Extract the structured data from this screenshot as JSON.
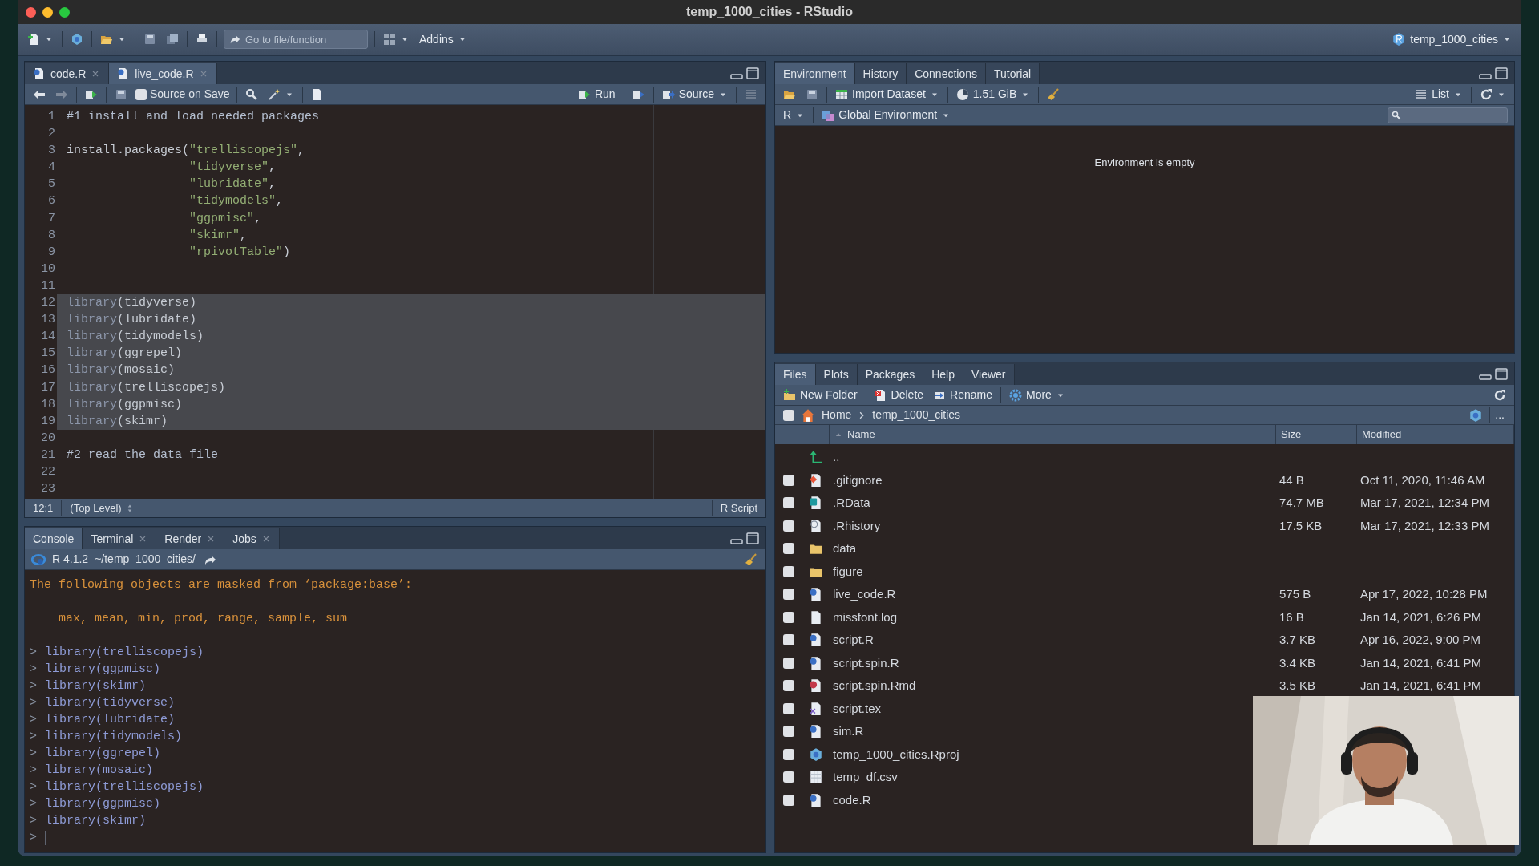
{
  "window": {
    "title": "temp_1000_cities - RStudio"
  },
  "toolbar": {
    "goto_placeholder": "Go to file/function",
    "addins": "Addins",
    "project": "temp_1000_cities"
  },
  "editor": {
    "tabs": [
      {
        "label": "code.R",
        "selected": false,
        "closable": true
      },
      {
        "label": "live_code.R",
        "selected": true,
        "closable": true
      }
    ],
    "toolbar": {
      "source_on_save": {
        "label": "Source on Save",
        "checked": false
      },
      "run": "Run",
      "source": "Source"
    },
    "lines": [
      {
        "num": "1",
        "selected": false,
        "tokens": [
          {
            "kind": "comment",
            "text": "#1 install and load needed packages"
          }
        ]
      },
      {
        "num": "2",
        "selected": false
      },
      {
        "num": "3",
        "selected": false,
        "tokens": [
          {
            "kind": "plain",
            "text": "install.packages("
          },
          {
            "kind": "string",
            "text": "\"trelliscopejs\""
          },
          {
            "kind": "plain",
            "text": ","
          }
        ]
      },
      {
        "num": "4",
        "selected": false,
        "kind": "continuation",
        "tokens": [
          {
            "kind": "string",
            "text": "\"tidyverse\""
          },
          {
            "kind": "plain",
            "text": ","
          }
        ]
      },
      {
        "num": "5",
        "selected": false,
        "kind": "continuation",
        "tokens": [
          {
            "kind": "string",
            "text": "\"lubridate\""
          },
          {
            "kind": "plain",
            "text": ","
          }
        ]
      },
      {
        "num": "6",
        "selected": false,
        "kind": "continuation",
        "tokens": [
          {
            "kind": "string",
            "text": "\"tidymodels\""
          },
          {
            "kind": "plain",
            "text": ","
          }
        ]
      },
      {
        "num": "7",
        "selected": false,
        "kind": "continuation",
        "tokens": [
          {
            "kind": "string",
            "text": "\"ggpmisc\""
          },
          {
            "kind": "plain",
            "text": ","
          }
        ]
      },
      {
        "num": "8",
        "selected": false,
        "kind": "continuation",
        "tokens": [
          {
            "kind": "string",
            "text": "\"skimr\""
          },
          {
            "kind": "plain",
            "text": ","
          }
        ]
      },
      {
        "num": "9",
        "selected": false,
        "kind": "continuation",
        "tokens": [
          {
            "kind": "string",
            "text": "\"rpivotTable\""
          },
          {
            "kind": "plain",
            "text": ")"
          }
        ]
      },
      {
        "num": "10",
        "selected": false
      },
      {
        "num": "11",
        "selected": false
      },
      {
        "num": "12",
        "selected": true,
        "tokens": [
          {
            "kind": "keyword",
            "text": "library"
          },
          {
            "kind": "plain",
            "text": "(tidyverse)"
          }
        ]
      },
      {
        "num": "13",
        "selected": true,
        "tokens": [
          {
            "kind": "keyword",
            "text": "library"
          },
          {
            "kind": "plain",
            "text": "(lubridate)"
          }
        ]
      },
      {
        "num": "14",
        "selected": true,
        "tokens": [
          {
            "kind": "keyword",
            "text": "library"
          },
          {
            "kind": "plain",
            "text": "(tidymodels)"
          }
        ]
      },
      {
        "num": "15",
        "selected": true,
        "tokens": [
          {
            "kind": "keyword",
            "text": "library"
          },
          {
            "kind": "plain",
            "text": "(ggrepel)"
          }
        ]
      },
      {
        "num": "16",
        "selected": true,
        "tokens": [
          {
            "kind": "keyword",
            "text": "library"
          },
          {
            "kind": "plain",
            "text": "(mosaic)"
          }
        ]
      },
      {
        "num": "17",
        "selected": true,
        "tokens": [
          {
            "kind": "keyword",
            "text": "library"
          },
          {
            "kind": "plain",
            "text": "(trelliscopejs)"
          }
        ]
      },
      {
        "num": "18",
        "selected": true,
        "tokens": [
          {
            "kind": "keyword",
            "text": "library"
          },
          {
            "kind": "plain",
            "text": "(ggpmisc)"
          }
        ]
      },
      {
        "num": "19",
        "selected": true,
        "tokens": [
          {
            "kind": "keyword",
            "text": "library"
          },
          {
            "kind": "plain",
            "text": "(skimr)"
          }
        ]
      },
      {
        "num": "20",
        "selected": false
      },
      {
        "num": "21",
        "selected": false,
        "tokens": [
          {
            "kind": "comment",
            "text": "#2 read the data file"
          }
        ]
      },
      {
        "num": "22",
        "selected": false
      },
      {
        "num": "23",
        "selected": false
      }
    ],
    "status": {
      "position": "12:1",
      "scope": "(Top Level)",
      "file_type": "R Script"
    }
  },
  "console": {
    "tabs": [
      {
        "label": "Console",
        "selected": true,
        "closable": false
      },
      {
        "label": "Terminal",
        "selected": false,
        "closable": true
      },
      {
        "label": "Render",
        "selected": false,
        "closable": true
      },
      {
        "label": "Jobs",
        "selected": false,
        "closable": true
      }
    ],
    "version": "R 4.1.2",
    "path": "~/temp_1000_cities/",
    "lines": [
      {
        "kind": "message",
        "text": "The following objects are masked from ‘package:base’:"
      },
      {
        "kind": "blank"
      },
      {
        "kind": "message",
        "text": "    max, mean, min, prod, range, sample, sum"
      },
      {
        "kind": "blank"
      },
      {
        "kind": "command",
        "prompt": ">",
        "text": "library(trelliscopejs)"
      },
      {
        "kind": "command",
        "prompt": ">",
        "text": "library(ggpmisc)"
      },
      {
        "kind": "command",
        "prompt": ">",
        "text": "library(skimr)"
      },
      {
        "kind": "command",
        "prompt": ">",
        "text": "library(tidyverse)"
      },
      {
        "kind": "command",
        "prompt": ">",
        "text": "library(lubridate)"
      },
      {
        "kind": "command",
        "prompt": ">",
        "text": "library(tidymodels)"
      },
      {
        "kind": "command",
        "prompt": ">",
        "text": "library(ggrepel)"
      },
      {
        "kind": "command",
        "prompt": ">",
        "text": "library(mosaic)"
      },
      {
        "kind": "command",
        "prompt": ">",
        "text": "library(trelliscopejs)"
      },
      {
        "kind": "command",
        "prompt": ">",
        "text": "library(ggpmisc)"
      },
      {
        "kind": "command",
        "prompt": ">",
        "text": "library(skimr)"
      },
      {
        "kind": "input",
        "prompt": ">"
      }
    ]
  },
  "environment": {
    "tabs": [
      {
        "label": "Environment",
        "selected": true,
        "closable": false
      },
      {
        "label": "History",
        "selected": false,
        "closable": false
      },
      {
        "label": "Connections",
        "selected": false,
        "closable": false
      },
      {
        "label": "Tutorial",
        "selected": false,
        "closable": false
      }
    ],
    "toolbar": {
      "import": "Import Dataset",
      "memory": "1.51 GiB",
      "view": "List"
    },
    "language": "R",
    "scope": "Global Environment",
    "message": "Environment is empty"
  },
  "files": {
    "tabs": [
      {
        "label": "Files",
        "selected": true,
        "closable": false
      },
      {
        "label": "Plots",
        "selected": false,
        "closable": false
      },
      {
        "label": "Packages",
        "selected": false,
        "closable": false
      },
      {
        "label": "Help",
        "selected": false,
        "closable": false
      },
      {
        "label": "Viewer",
        "selected": false,
        "closable": false
      }
    ],
    "toolbar": {
      "new_folder": "New Folder",
      "delete": "Delete",
      "rename": "Rename",
      "more": "More"
    },
    "select_all_checked": false,
    "breadcrumb": [
      "Home",
      "temp_1000_cities"
    ],
    "more_label": "...",
    "columns": [
      "Name",
      "Size",
      "Modified"
    ],
    "rows": [
      {
        "kind": "up",
        "name": ".."
      },
      {
        "kind": "git",
        "name": ".gitignore",
        "checked": false,
        "size": "44 B",
        "modified": "Oct 11, 2020, 11:46 AM"
      },
      {
        "kind": "rdata",
        "name": ".RData",
        "checked": false,
        "size": "74.7 MB",
        "modified": "Mar 17, 2021, 12:34 PM"
      },
      {
        "kind": "history",
        "name": ".Rhistory",
        "checked": false,
        "size": "17.5 KB",
        "modified": "Mar 17, 2021, 12:33 PM"
      },
      {
        "kind": "folder",
        "name": "data",
        "checked": false
      },
      {
        "kind": "folder",
        "name": "figure",
        "checked": false
      },
      {
        "kind": "rscript",
        "name": "live_code.R",
        "checked": false,
        "size": "575 B",
        "modified": "Apr 17, 2022, 10:28 PM"
      },
      {
        "kind": "file",
        "name": "missfont.log",
        "checked": false,
        "size": "16 B",
        "modified": "Jan 14, 2021, 6:26 PM"
      },
      {
        "kind": "rscript",
        "name": "script.R",
        "checked": false,
        "size": "3.7 KB",
        "modified": "Apr 16, 2022, 9:00 PM"
      },
      {
        "kind": "rscript",
        "name": "script.spin.R",
        "checked": false,
        "size": "3.4 KB",
        "modified": "Jan 14, 2021, 6:41 PM"
      },
      {
        "kind": "rmd",
        "name": "script.spin.Rmd",
        "checked": false,
        "size": "3.5 KB",
        "modified": "Jan 14, 2021, 6:41 PM"
      },
      {
        "kind": "tex",
        "name": "script.tex",
        "checked": false
      },
      {
        "kind": "rscript",
        "name": "sim.R",
        "checked": false
      },
      {
        "kind": "rproj",
        "name": "temp_1000_cities.Rproj",
        "checked": false
      },
      {
        "kind": "csv",
        "name": "temp_df.csv",
        "checked": false
      },
      {
        "kind": "rscript",
        "name": "code.R",
        "checked": false
      }
    ]
  }
}
